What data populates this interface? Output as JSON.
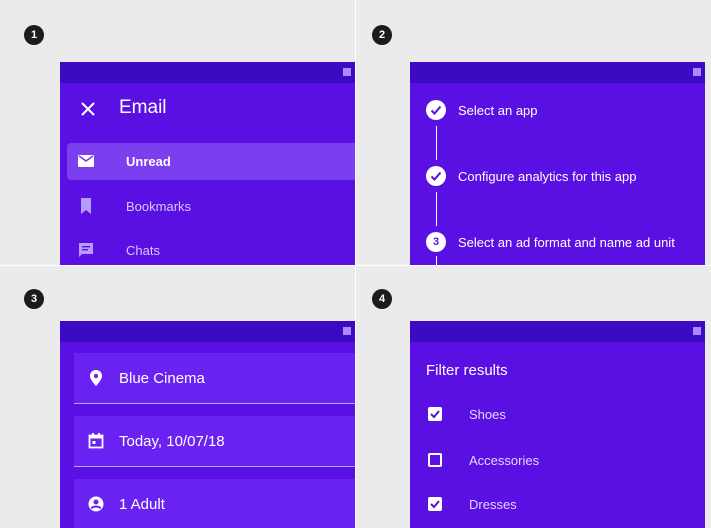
{
  "panels": {
    "p1": {
      "number": "1",
      "drawer": {
        "title": "Email",
        "close_icon": "close-icon",
        "items": [
          {
            "label": "Unread",
            "icon": "mail-icon",
            "active": true
          },
          {
            "label": "Bookmarks",
            "icon": "bookmark-icon",
            "active": false
          },
          {
            "label": "Chats",
            "icon": "chat-icon",
            "active": false
          }
        ]
      }
    },
    "p2": {
      "number": "2",
      "stepper": {
        "steps": [
          {
            "label": "Select an app",
            "state": "complete",
            "icon": "check-icon"
          },
          {
            "label": "Configure analytics for this app",
            "state": "complete",
            "icon": "check-icon"
          },
          {
            "label": "Select an ad format and name ad unit",
            "state": "active",
            "number": "3"
          }
        ]
      }
    },
    "p3": {
      "number": "3",
      "fields": [
        {
          "label": "Blue Cinema",
          "icon": "location-pin-icon"
        },
        {
          "label": "Today, 10/07/18",
          "icon": "calendar-icon"
        },
        {
          "label": "1 Adult",
          "icon": "account-icon"
        }
      ]
    },
    "p4": {
      "number": "4",
      "filter": {
        "title": "Filter results",
        "options": [
          {
            "label": "Shoes",
            "checked": true
          },
          {
            "label": "Accessories",
            "checked": false
          },
          {
            "label": "Dresses",
            "checked": true
          }
        ]
      }
    }
  },
  "colors": {
    "screen": "#5b10e3",
    "status_bar": "#3c0ac2",
    "active_item": "#7c3ff0",
    "field_bg": "#6a22f2",
    "background": "#ebebeb",
    "badge": "#1c1c1c"
  }
}
